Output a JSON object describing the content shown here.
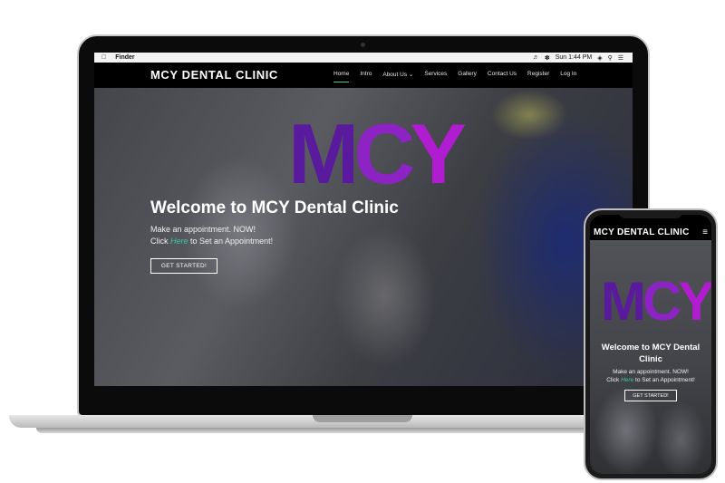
{
  "menubar": {
    "app_name": "Finder",
    "clock": "Sun 1:44 PM",
    "icons": [
      "apple-icon",
      "volume-icon",
      "bluetooth-icon",
      "wifi-icon",
      "search-icon",
      "list-icon"
    ]
  },
  "site": {
    "brand": "MCY DENTAL CLINIC",
    "nav": [
      {
        "label": "Home",
        "active": true
      },
      {
        "label": "Intro"
      },
      {
        "label": "About Us ⌄"
      },
      {
        "label": "Services"
      },
      {
        "label": "Gallery"
      },
      {
        "label": "Contact Us"
      },
      {
        "label": "Register"
      },
      {
        "label": "Log In"
      }
    ],
    "hero": {
      "logo_m": "M",
      "logo_c": "C",
      "logo_y": "Y",
      "title": "Welcome to MCY Dental Clinic",
      "line1": "Make an appointment. NOW!",
      "line2_pre": "Click ",
      "line2_link": "Here",
      "line2_post": " to Set an Appointment!",
      "cta": "GET STARTED!"
    }
  },
  "mobile": {
    "brand": "MCY DENTAL CLINIC",
    "menu_icon": "≡",
    "logo_m": "M",
    "logo_c": "C",
    "logo_y": "Y",
    "title": "Welcome to MCY Dental Clinic",
    "line1": "Make an appointment. NOW!",
    "line2_pre": "Click ",
    "line2_link": "Here",
    "line2_post": " to Set an Appointment!",
    "cta": "GET STARTED!"
  },
  "colors": {
    "accent": "#3cc8a5",
    "logo_purple_dark": "#5a1a9e",
    "logo_purple": "#8d23c4",
    "logo_magenta": "#b01ccf"
  }
}
